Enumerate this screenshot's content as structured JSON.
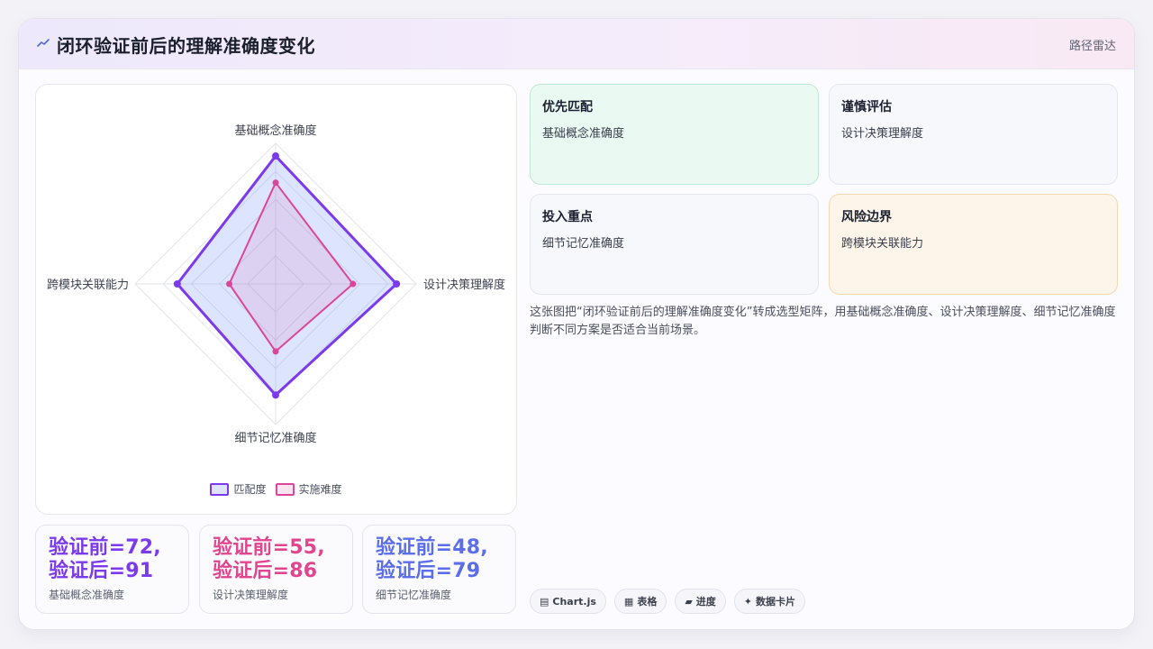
{
  "header": {
    "title": "闭环验证前后的理解准确度变化",
    "tag": "路径雷达"
  },
  "chart_data": {
    "type": "radar",
    "axes": [
      "基础概念准确度",
      "设计决策理解度",
      "细节记忆准确度",
      "跨模块关联能力"
    ],
    "rmax": 100,
    "series": [
      {
        "name": "匹配度",
        "values": [
          91,
          86,
          79,
          70
        ],
        "color": "#7c3aed"
      },
      {
        "name": "实施难度",
        "values": [
          72,
          55,
          48,
          33
        ],
        "color": "#d9469a"
      }
    ]
  },
  "stats": [
    {
      "line1": "验证前=72,",
      "line2": "验证后=91",
      "label": "基础概念准确度",
      "color": "#7c3aed"
    },
    {
      "line1": "验证前=55,",
      "line2": "验证后=86",
      "label": "设计决策理解度",
      "color": "#e0468f"
    },
    {
      "line1": "验证前=48,",
      "line2": "验证后=79",
      "label": "细节记忆准确度",
      "color": "#5b6ee8"
    }
  ],
  "quadrants": [
    {
      "title": "优先匹配",
      "sub": "基础概念准确度"
    },
    {
      "title": "谨慎评估",
      "sub": "设计决策理解度"
    },
    {
      "title": "投入重点",
      "sub": "细节记忆准确度"
    },
    {
      "title": "风险边界",
      "sub": "跨模块关联能力"
    }
  ],
  "description": "这张图把“闭环验证前后的理解准确度变化”转成选型矩阵，用基础概念准确度、设计决策理解度、细节记忆准确度判断不同方案是否适合当前场景。",
  "chips": [
    {
      "icon": "▤",
      "label": "Chart.js"
    },
    {
      "icon": "▦",
      "label": "表格"
    },
    {
      "icon": "▰",
      "label": "进度"
    },
    {
      "icon": "✦",
      "label": "数据卡片"
    }
  ]
}
